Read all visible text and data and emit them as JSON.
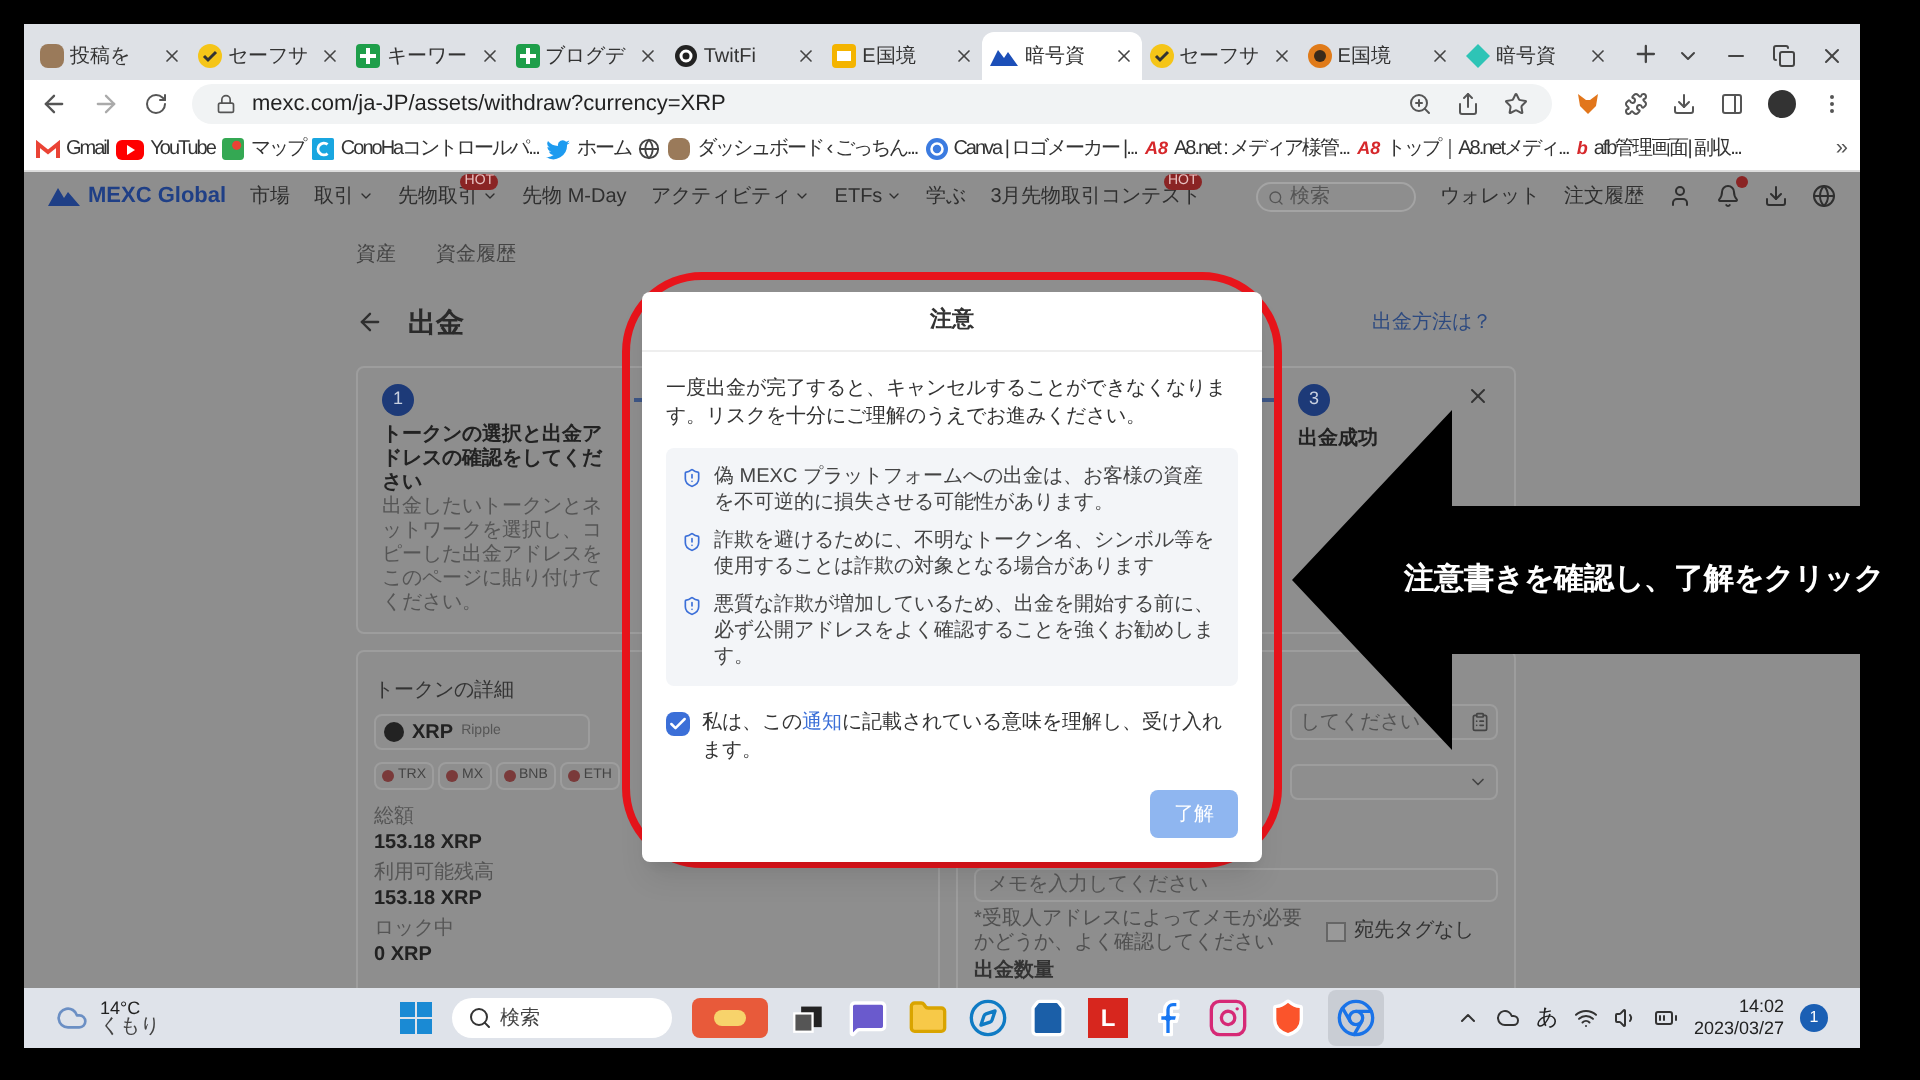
{
  "browser": {
    "tabs": [
      {
        "title": "投稿を",
        "kind": "avatar",
        "selected": false
      },
      {
        "title": "セーフサ",
        "kind": "check",
        "selected": false
      },
      {
        "title": "キーワー",
        "kind": "sheets",
        "selected": false
      },
      {
        "title": "ブログデ",
        "kind": "sheets",
        "selected": false
      },
      {
        "title": "TwitFi",
        "kind": "ring",
        "selected": false
      },
      {
        "title": "E国境",
        "kind": "slides",
        "selected": false
      },
      {
        "title": "暗号資",
        "kind": "mountain",
        "selected": true
      },
      {
        "title": "セーフサ",
        "kind": "check",
        "selected": false
      },
      {
        "title": "E国境",
        "kind": "coin",
        "selected": false
      },
      {
        "title": "暗号資",
        "kind": "diamond",
        "selected": false
      }
    ],
    "url": "mexc.com/ja-JP/assets/withdraw?currency=XRP",
    "bookmarks": [
      {
        "label": "Gmail",
        "kind": "mail"
      },
      {
        "label": "YouTube",
        "kind": "play"
      },
      {
        "label": "マップ",
        "kind": "pin"
      },
      {
        "label": "ConoHaコントロールパ...",
        "kind": "square"
      },
      {
        "label": "ホーム",
        "kind": "bird"
      },
      {
        "kind": "globe"
      },
      {
        "label": "ダッシュボード ‹ ごっちん...",
        "kind": "avatar"
      },
      {
        "label": "Canva | ロゴメーカー |...",
        "kind": "circle"
      },
      {
        "label": "A8.net : メディア様管...",
        "kind": "logo",
        "logo": "A8"
      },
      {
        "label": "トップ｜A8.netメディ...",
        "kind": "logo",
        "logo": "A8"
      },
      {
        "label": "afb管理画面| 副収...",
        "kind": "logo",
        "logo": "b"
      }
    ],
    "more": "»"
  },
  "site": {
    "logo": "MEXC Global",
    "nav": [
      {
        "label": "市場",
        "dropdown": false
      },
      {
        "label": "取引",
        "dropdown": true
      },
      {
        "label": "先物取引",
        "dropdown": true,
        "badge": "HOT"
      },
      {
        "label": "先物 M-Day",
        "dropdown": false
      },
      {
        "label": "アクティビティ",
        "dropdown": true
      },
      {
        "label": "ETFs",
        "dropdown": true
      },
      {
        "label": "学ぶ",
        "dropdown": false
      },
      {
        "label": "3月先物取引コンテスト",
        "dropdown": false,
        "badge": "HOT"
      }
    ],
    "search_placeholder": "検索",
    "links": [
      "ウォレット",
      "注文履歴"
    ]
  },
  "breadcrumbs": [
    "資産",
    "資金履歴"
  ],
  "page_title": "出金",
  "help_link": "出金方法は？",
  "steps": [
    {
      "number": "1",
      "title": "トークンの選択と出金アドレスの確認をしてください",
      "description": "出金したいトークンとネットワークを選択し、コピーした出金アドレスをこのページに貼り付けてください。"
    },
    {
      "number": "3",
      "title": "出金成功"
    }
  ],
  "token_details": {
    "label": "トークンの詳細",
    "token": "XRP",
    "token_name": "Ripple",
    "networks": [
      "TRX",
      "MX",
      "BNB",
      "ETH"
    ],
    "balances": [
      {
        "label": "総額",
        "value": "153.18 XRP"
      },
      {
        "label": "利用可能残高",
        "value": "153.18 XRP"
      },
      {
        "label": "ロック中",
        "value": "0 XRP"
      }
    ]
  },
  "withdraw_form": {
    "address_placeholder": "してください",
    "memo_placeholder": "メモを入力してください",
    "memo_note": "*受取人アドレスによってメモが必要かどうか、よく確認してください",
    "no_tag": {
      "label": "宛先タグなし",
      "checked": false
    },
    "amount_label": "出金数量"
  },
  "dialog": {
    "title": "注意",
    "message": "一度出金が完了すると、キャンセルすることができなくなります。リスクを十分にご理解のうえでお進みください。",
    "warnings": [
      "偽 MEXC プラットフォームへの出金は、お客様の資産を不可逆的に損失させる可能性があります。",
      "詐欺を避けるために、不明なトークン名、シンボル等を使用することは詐欺の対象となる場合があります",
      "悪質な詐欺が増加しているため、出金を開始する前に、必ず公開アドレスをよく確認することを強くお勧めします。"
    ],
    "agreement": {
      "before": "私は、この",
      "link": "通知",
      "after": "に記載されている意味を理解し、受け入れます。",
      "checked": true
    },
    "confirm_button": "了解"
  },
  "annotation": "注意書きを確認し、了解をクリック",
  "taskbar": {
    "weather": {
      "temp": "14°C",
      "condition": "くもり"
    },
    "search_placeholder": "検索",
    "apps": [
      {
        "kind": "widgets"
      },
      {
        "kind": "taskview"
      },
      {
        "kind": "chat"
      },
      {
        "kind": "folder"
      },
      {
        "kind": "edge"
      },
      {
        "kind": "store"
      },
      {
        "kind": "letter",
        "label": "L"
      },
      {
        "kind": "facebook"
      },
      {
        "kind": "instagram"
      },
      {
        "kind": "brave"
      },
      {
        "kind": "chrome"
      }
    ],
    "ime": "あ",
    "time": "14:02",
    "date": "2023/03/27",
    "notifications": "1"
  }
}
